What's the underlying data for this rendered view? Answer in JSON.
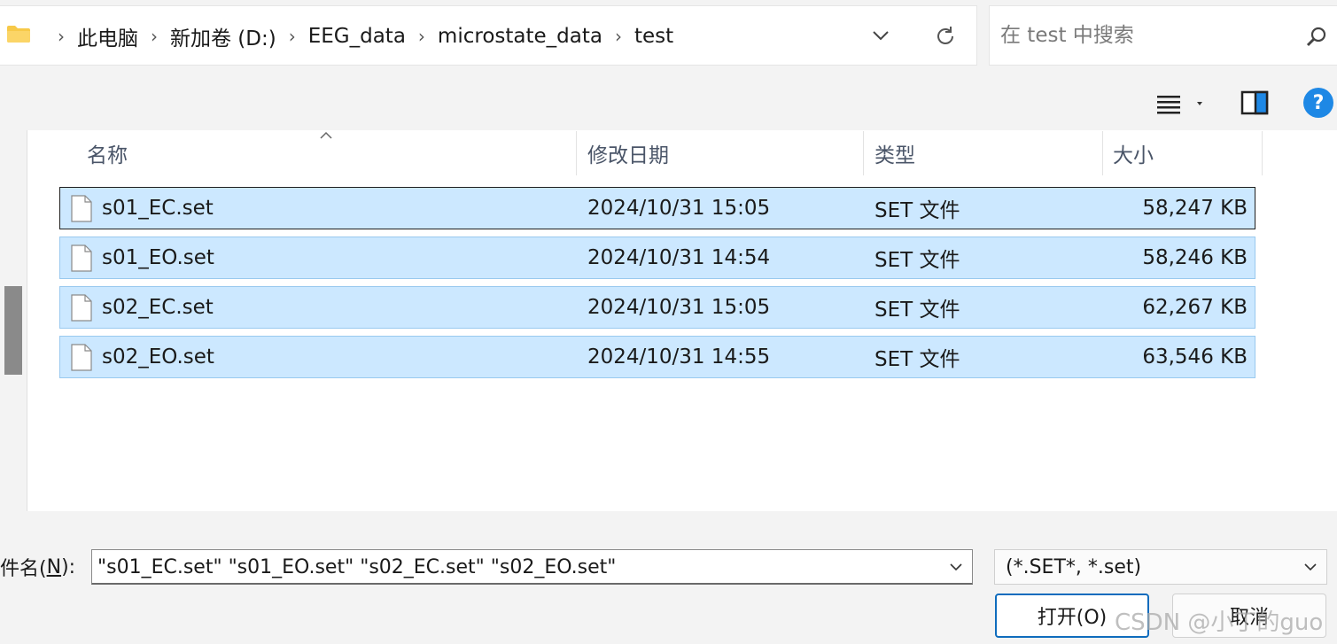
{
  "address": {
    "crumbs": [
      "此电脑",
      "新加卷 (D:)",
      "EEG_data",
      "microstate_data",
      "test"
    ]
  },
  "search": {
    "placeholder": "在 test 中搜索"
  },
  "columns": {
    "name": "名称",
    "date": "修改日期",
    "type": "类型",
    "size": "大小"
  },
  "files": [
    {
      "name": "s01_EC.set",
      "date": "2024/10/31 15:05",
      "type": "SET 文件",
      "size": "58,247 KB",
      "focused": true
    },
    {
      "name": "s01_EO.set",
      "date": "2024/10/31 14:54",
      "type": "SET 文件",
      "size": "58,246 KB"
    },
    {
      "name": "s02_EC.set",
      "date": "2024/10/31 15:05",
      "type": "SET 文件",
      "size": "62,267 KB"
    },
    {
      "name": "s02_EO.set",
      "date": "2024/10/31 14:55",
      "type": "SET 文件",
      "size": "63,546 KB"
    }
  ],
  "filename": {
    "label_prefix": "件名(",
    "label_key": "N",
    "label_suffix": "):",
    "value": "\"s01_EC.set\" \"s01_EO.set\" \"s02_EC.set\" \"s02_EO.set\""
  },
  "filetype": {
    "selected": "(*.SET*, *.set)"
  },
  "buttons": {
    "open": "打开(O)",
    "cancel": "取消"
  },
  "watermark": "CSDN @小丁的guo",
  "colors": {
    "selection_bg": "#cce8ff",
    "selection_border": "#99c9ef",
    "accent": "#0f6cbd",
    "help_blue": "#1e88e5",
    "folder": "#f7c948"
  }
}
